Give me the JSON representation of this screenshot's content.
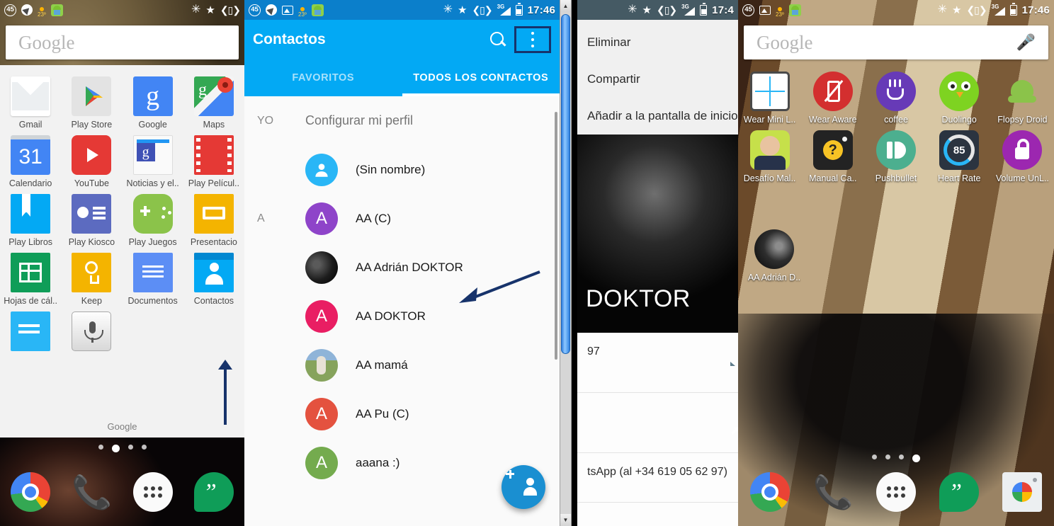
{
  "status_bar": {
    "left_icons": [
      "dnd-45-icon",
      "navigation-icon",
      "screenshot-icon",
      "weather-icon",
      "android-icon"
    ],
    "right_icons": [
      "bluetooth-icon",
      "star-icon",
      "vibrate-icon",
      "signal-3g-icon",
      "battery-icon"
    ],
    "network": "3G",
    "clock": "17:46",
    "dnd_badge": "45",
    "temperature": "23º"
  },
  "panel1": {
    "name": "home-screen-folder",
    "search": {
      "placeholder": "Google",
      "mic_icon": "microphone-icon"
    },
    "folder_label": "Google",
    "apps": [
      {
        "label": "Gmail",
        "icon": "gmail-icon"
      },
      {
        "label": "Play Store",
        "icon": "play-store-icon"
      },
      {
        "label": "Google",
        "icon": "google-search-icon"
      },
      {
        "label": "Maps",
        "icon": "google-maps-icon"
      },
      {
        "label": "Calendario",
        "icon": "calendar-icon"
      },
      {
        "label": "YouTube",
        "icon": "youtube-icon"
      },
      {
        "label": "Noticias y el..",
        "icon": "news-weather-icon"
      },
      {
        "label": "Play Películ..",
        "icon": "play-movies-icon"
      },
      {
        "label": "Play Libros",
        "icon": "play-books-icon"
      },
      {
        "label": "Play Kiosco",
        "icon": "play-newsstand-icon"
      },
      {
        "label": "Play Juegos",
        "icon": "play-games-icon"
      },
      {
        "label": "Presentacio",
        "icon": "google-slides-icon"
      },
      {
        "label": "Hojas de cál..",
        "icon": "google-sheets-icon"
      },
      {
        "label": "Keep",
        "icon": "google-keep-icon"
      },
      {
        "label": "Documentos",
        "icon": "google-docs-icon"
      },
      {
        "label": "Contactos",
        "icon": "contacts-icon"
      },
      {
        "label": "",
        "icon": "google-docs-old-icon"
      },
      {
        "label": "",
        "icon": "voice-search-icon"
      }
    ],
    "page_dots": {
      "count": 4,
      "active_index": 1
    },
    "dock": [
      {
        "label": "Chrome",
        "icon": "chrome-icon"
      },
      {
        "label": "Teléfono",
        "icon": "phone-icon"
      },
      {
        "label": "Todas las aplicaciones",
        "icon": "all-apps-icon"
      },
      {
        "label": "Hangouts",
        "icon": "hangouts-icon"
      }
    ],
    "annotation": {
      "type": "arrow-up",
      "points_to": "Contactos"
    }
  },
  "panel2": {
    "name": "contacts-app",
    "title": "Contactos",
    "search_icon": "search-icon",
    "overflow_icon": "overflow-menu-icon",
    "tabs": [
      {
        "label": "FAVORITOS",
        "active": false
      },
      {
        "label": "TODOS LOS CONTACTOS",
        "active": true
      }
    ],
    "sections": [
      {
        "letter": "YO"
      },
      {
        "letter": "A"
      }
    ],
    "profile_row": {
      "section": "YO",
      "label": "Configurar mi perfil"
    },
    "contacts": [
      {
        "section": "",
        "name": "(Sin nombre)",
        "avatar_type": "person-icon",
        "avatar_color": "#29b6f6",
        "initial": ""
      },
      {
        "section": "A",
        "name": "AA (C)",
        "avatar_type": "initial",
        "avatar_color": "#8e44c9",
        "initial": "A"
      },
      {
        "section": "",
        "name": "AA Adrián DOKTOR",
        "avatar_type": "photo-dark",
        "avatar_color": "#111111",
        "initial": ""
      },
      {
        "section": "",
        "name": "AA DOKTOR",
        "avatar_type": "initial",
        "avatar_color": "#e91e63",
        "initial": "A"
      },
      {
        "section": "",
        "name": "AA mamá",
        "avatar_type": "photo-field",
        "avatar_color": "#7e9b5a",
        "initial": ""
      },
      {
        "section": "",
        "name": "AA Pu (C)",
        "avatar_type": "initial",
        "avatar_color": "#e4523f",
        "initial": "A"
      },
      {
        "section": "",
        "name": "aaana :)",
        "avatar_type": "initial",
        "avatar_color": "#74ab4e",
        "initial": "A"
      }
    ],
    "fab": {
      "icon": "add-contact-icon",
      "color": "#1a8fd1"
    },
    "annotation": {
      "type": "arrow-pointing-left-down",
      "points_to": "AA Adrián DOKTOR",
      "color": "#17336b"
    }
  },
  "window_scrollbar": {
    "name": "window-scrollbar",
    "up_arrow": "▲",
    "down_arrow": "▼"
  },
  "panel3": {
    "name": "contact-detail-with-overflow-menu",
    "menu_items": [
      "Eliminar",
      "Compartir",
      "Añadir a la pantalla de inicio"
    ],
    "contact_name": "DOKTOR",
    "detail_rows": [
      {
        "text": "97",
        "icon": "sms-icon"
      },
      {
        "text": "",
        "icon": "directions-icon"
      },
      {
        "text": "tsApp (al +34 619 05 62 97)",
        "icon": ""
      }
    ],
    "annotation": {
      "type": "arrow-down",
      "points_to": "Añadir a la pantalla de inicio",
      "color": "#17336b"
    }
  },
  "panel4": {
    "name": "home-screen-with-new-shortcut",
    "search": {
      "placeholder": "Google",
      "mic_icon": "microphone-icon"
    },
    "apps": [
      {
        "label": "Wear Mini L..",
        "icon": "wear-mini-launcher-icon"
      },
      {
        "label": "Wear Aware",
        "icon": "wear-aware-icon"
      },
      {
        "label": "coffee",
        "icon": "coffee-icon"
      },
      {
        "label": "Duolingo",
        "icon": "duolingo-icon"
      },
      {
        "label": "Flopsy Droid",
        "icon": "flopsy-droid-icon"
      },
      {
        "label": "Desafío Mal..",
        "icon": "desafio-icon"
      },
      {
        "label": "Manual Ca..",
        "icon": "manual-camera-icon"
      },
      {
        "label": "Pushbullet",
        "icon": "pushbullet-icon"
      },
      {
        "label": "Heart Rate",
        "icon": "heart-rate-icon",
        "badge": "85"
      },
      {
        "label": "Volume UnL..",
        "icon": "volume-unlock-icon"
      }
    ],
    "new_shortcut": {
      "label": "AA Adrián D..",
      "icon": "contact-photo-shortcut"
    },
    "page_dots": {
      "count": 4,
      "active_index": 3
    },
    "dock": [
      {
        "label": "Chrome",
        "icon": "chrome-icon"
      },
      {
        "label": "Teléfono",
        "icon": "phone-icon"
      },
      {
        "label": "Todas las aplicaciones",
        "icon": "all-apps-icon"
      },
      {
        "label": "Hangouts",
        "icon": "hangouts-icon"
      },
      {
        "label": "Cámara",
        "icon": "camera-icon"
      }
    ],
    "annotation": {
      "type": "arrow-down-left",
      "points_to": "AA Adrián D..",
      "color": "#1b55c4"
    }
  }
}
